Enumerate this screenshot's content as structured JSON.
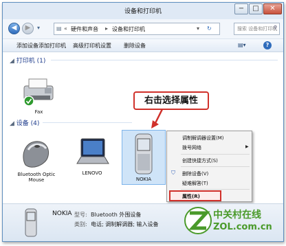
{
  "window": {
    "title": "设备和打印机"
  },
  "address": {
    "chevron": "«",
    "crumbs": [
      "硬件和声音",
      "设备和打印机"
    ],
    "separator": "▸",
    "search_placeholder": "搜索 设备和打印机"
  },
  "toolbar": {
    "add_device": "添加设备",
    "add_printer": "添加打印机",
    "advanced_print": "高级打印机设置",
    "remove_device": "删除设备"
  },
  "groups": {
    "printers": "打印机 (1)",
    "devices": "设备 (4)"
  },
  "devices": {
    "fax": "Fax",
    "mouse": "Bluetooth Optic Mouse",
    "lenovo": "LENOVO",
    "nokia": "NOKIA"
  },
  "context_menu": {
    "items": [
      "调制解调器设置(M)",
      "拨号网络",
      "创建快捷方式(S)",
      "删除设备(V)",
      "疑难解答(T)",
      "属性(R)"
    ]
  },
  "callout": "右击选择属性",
  "status": {
    "device_name": "NOKIA",
    "model_label": "型号:",
    "model_value": "Bluetooth 外围设备",
    "category_label": "类别:",
    "category_value": "电话; 调制解调器; 输入设备"
  },
  "watermark": {
    "brand": "中关村在线",
    "url": "ZOL.com.cn"
  },
  "colors": {
    "accent": "#1e3c8c",
    "highlight_red": "#d0302a",
    "watermark_green": "#4a9a2a"
  }
}
